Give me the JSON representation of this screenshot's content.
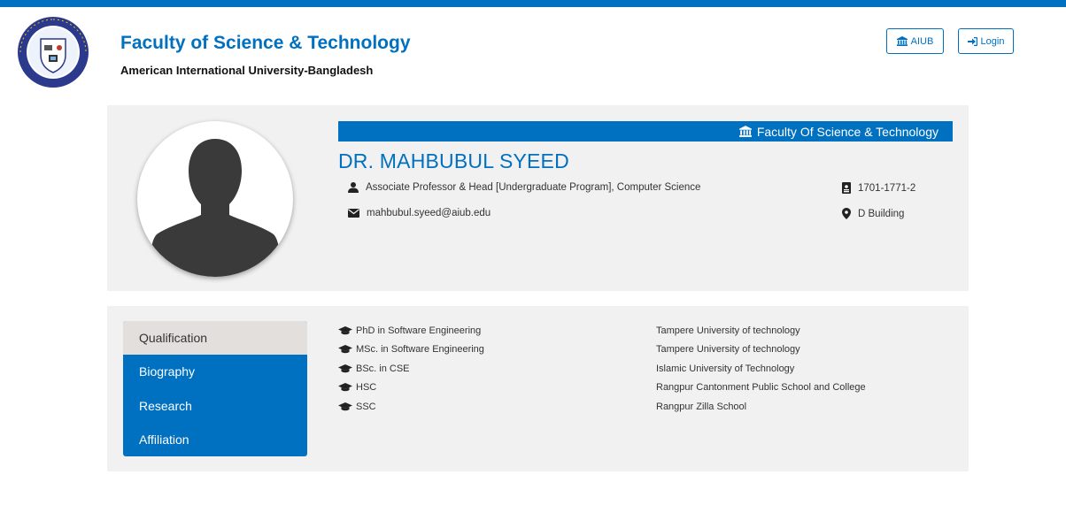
{
  "colors": {
    "primary": "#0070c0",
    "panel": "#f1f1f1",
    "active_tab": "#e3dfdd"
  },
  "header": {
    "title": "Faculty of Science & Technology",
    "subtitle": "American International University-Bangladesh",
    "buttons": {
      "aiub": {
        "label": "AIUB",
        "icon": "university-icon"
      },
      "login": {
        "label": "Login",
        "icon": "sign-in-icon"
      }
    }
  },
  "profile": {
    "faculty_bar": "Faculty Of Science & Technology",
    "name": "DR. MAHBUBUL SYEED",
    "designation": "Associate Professor & Head [Undergraduate Program], Computer Science",
    "email": "mahbubul.syeed@aiub.edu",
    "room": "1701-1771-2",
    "building": "D Building"
  },
  "tabs": [
    {
      "label": "Qualification",
      "active": true
    },
    {
      "label": "Biography",
      "active": false
    },
    {
      "label": "Research",
      "active": false
    },
    {
      "label": "Affiliation",
      "active": false
    }
  ],
  "qualifications": [
    {
      "degree": "PhD in Software Engineering",
      "institution": "Tampere University of technology"
    },
    {
      "degree": "MSc. in Software Engineering",
      "institution": "Tampere University of technology"
    },
    {
      "degree": "BSc. in CSE",
      "institution": "Islamic University of Technology"
    },
    {
      "degree": "HSC",
      "institution": "Rangpur Cantonment Public School and College"
    },
    {
      "degree": "SSC",
      "institution": "Rangpur Zilla School"
    }
  ]
}
